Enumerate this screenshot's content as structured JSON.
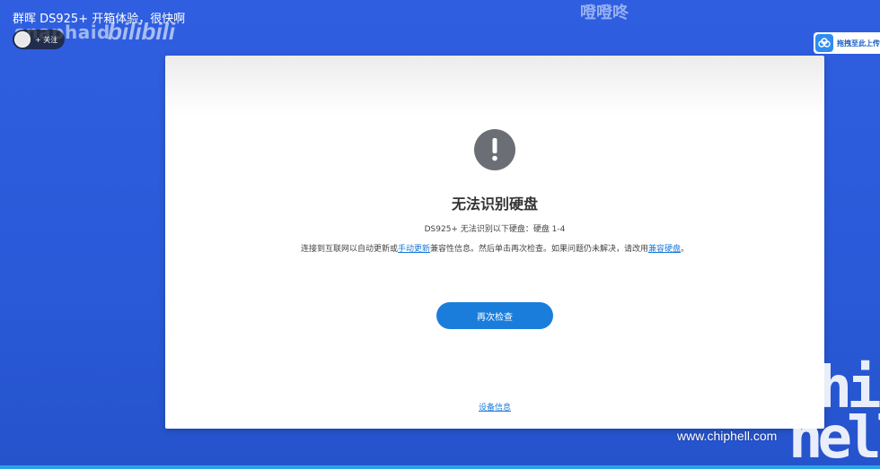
{
  "video": {
    "title": "群晖 DS925+ 开箱体验，很快啊",
    "channel_watermark": "snaphaid",
    "platform_logo": "bilibili",
    "follow_label": "+ 关注",
    "top_watermark": "噔噔咚",
    "upload_label": "拖拽至此上传"
  },
  "dialog": {
    "title": "无法识别硬盘",
    "subtitle": "DS925+ 无法识别以下硬盘：硬盘 1-4",
    "desc_prefix": "连接到互联网以自动更新或",
    "desc_link1": "手动更新",
    "desc_middle": "兼容性信息。然后单击再次检查。如果问题仍未解决，请改用",
    "desc_link2": "兼容硬盘",
    "desc_suffix": "。",
    "recheck_button": "再次检查",
    "device_info_link": "设备信息"
  },
  "watermark": {
    "logo_line1": "chip",
    "logo_line2": "hell",
    "url": "www.chiphell.com"
  },
  "colors": {
    "background": "#2f5ee0",
    "accent": "#1a7ddb",
    "alert_icon": "#6b6e75"
  },
  "icons": {
    "alert": "exclamation-circle-icon",
    "upload": "cloud-upload-icon"
  }
}
